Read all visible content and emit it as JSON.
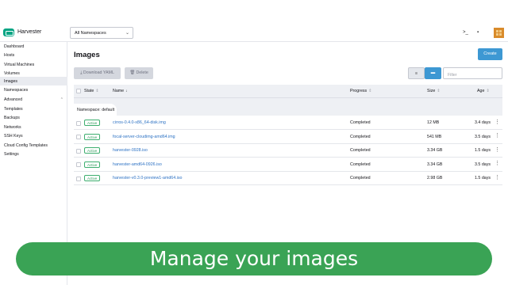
{
  "header": {
    "brand": "Harvester",
    "namespace_select": "All Namespaces",
    "icons": [
      "terminal-icon",
      "file-icon",
      "avatar"
    ]
  },
  "sidebar": {
    "items": [
      {
        "label": "Dashboard"
      },
      {
        "label": "Hosts"
      },
      {
        "label": "Virtual Machines"
      },
      {
        "label": "Volumes"
      },
      {
        "label": "Images",
        "active": true
      },
      {
        "label": "Namespaces"
      },
      {
        "label": "Advanced",
        "expanded": true
      },
      {
        "label": "Templates"
      },
      {
        "label": "Backups"
      },
      {
        "label": "Networks"
      },
      {
        "label": "SSH Keys"
      },
      {
        "label": "Cloud Config Templates"
      },
      {
        "label": "Settings"
      }
    ]
  },
  "main": {
    "title": "Images",
    "create_label": "Create",
    "download_label": "Download YAML",
    "delete_label": "Delete",
    "filter_placeholder": "Filter",
    "columns": [
      "State",
      "Name",
      "Progress",
      "Size",
      "Age"
    ],
    "group_prefix": "Namespace:",
    "group_value": "default",
    "rows": [
      {
        "state": "Active",
        "name": "cirros-0.4.0-x86_64-disk.img",
        "progress": "Completed",
        "size": "12 MB",
        "age": "3.4 days"
      },
      {
        "state": "Active",
        "name": "focal-server-cloudimg-amd64.img",
        "progress": "Completed",
        "size": "541 MB",
        "age": "3.5 days"
      },
      {
        "state": "Active",
        "name": "harvester-0928.iso",
        "progress": "Completed",
        "size": "3.34 GB",
        "age": "1.5 days"
      },
      {
        "state": "Active",
        "name": "harvester-amd64-0926.iso",
        "progress": "Completed",
        "size": "3.34 GB",
        "age": "3.5 days"
      },
      {
        "state": "Active",
        "name": "harvester-v0.3.0-preview1-amd64.iso",
        "progress": "Completed",
        "size": "2.98 GB",
        "age": "1.5 days"
      }
    ]
  },
  "banner": {
    "text": "Manage your images"
  },
  "colors": {
    "accent": "#3d98d3",
    "brand_green": "#00a483",
    "banner_green": "#3aa355",
    "link": "#2d72c4",
    "active_badge": "#2f9c5c"
  }
}
